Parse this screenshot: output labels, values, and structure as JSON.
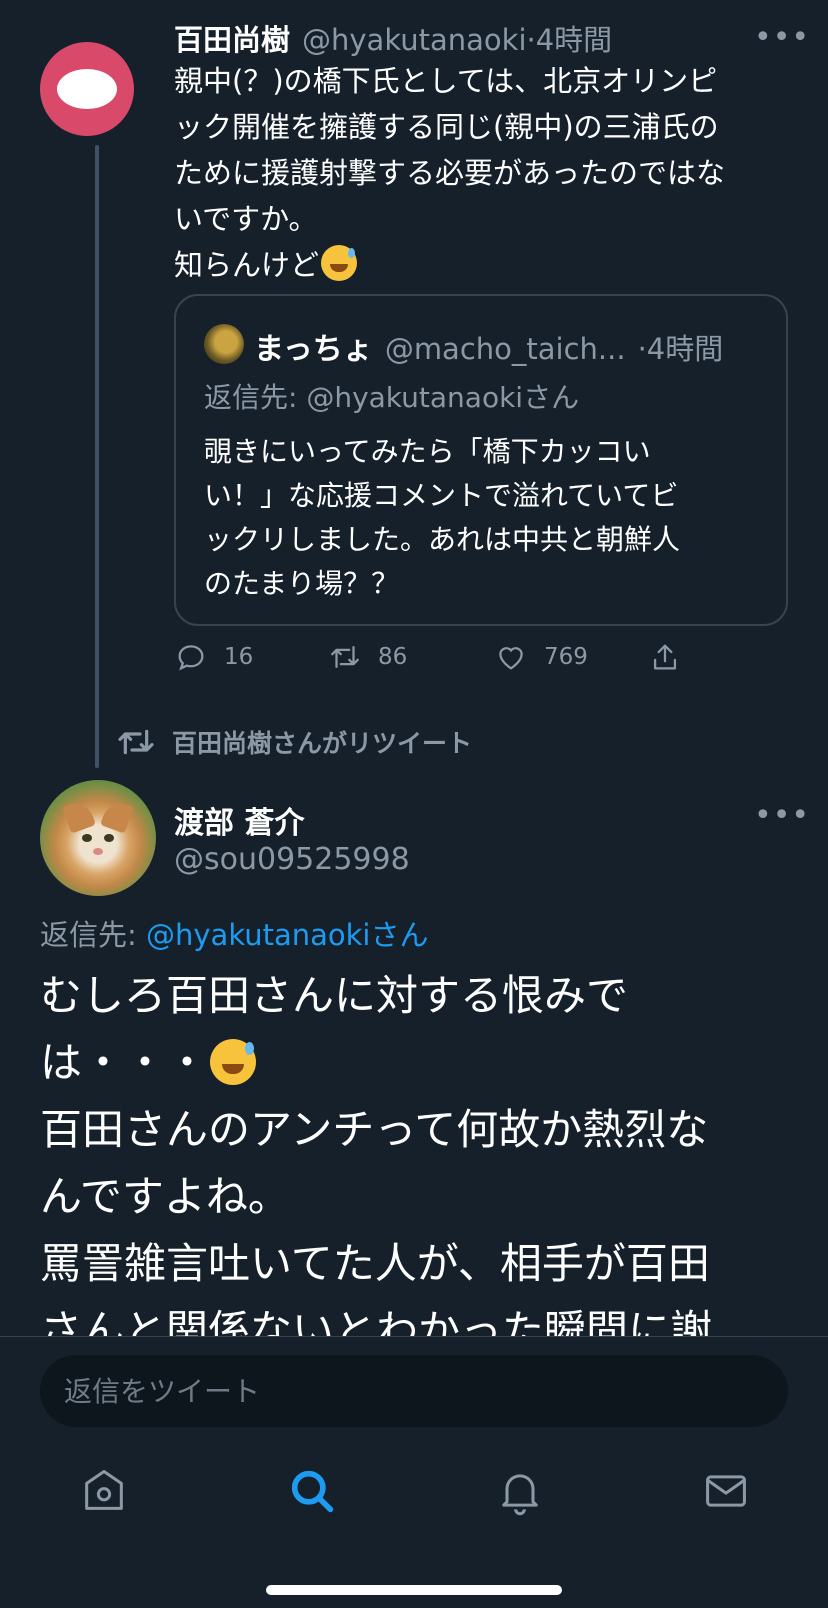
{
  "tweet1": {
    "name": "百田尚樹",
    "handle": "@hyakutanaoki",
    "time": "·4時間",
    "text_lines": [
      "親中(？)の橋下氏としては、北京オリンピ",
      "ック開催を擁護する同じ(親中)の三浦氏の",
      "ために援護射撃する必要があったのではな",
      "いですか。",
      "知らんけど"
    ],
    "emoji": "grinning-face-with-sweat",
    "quote": {
      "name": "まっちょ",
      "handle": "@macho_taich...",
      "time": "·4時間",
      "reply_to": "返信先: @hyakutanaokiさん",
      "text_lines": [
        "覗きにいってみたら「橋下カッコい",
        "い！」な応援コメントで溢れていてビ",
        "ックリしました。あれは中共と朝鮮人",
        "のたまり場？？"
      ]
    },
    "actions": {
      "replies": "16",
      "retweets": "86",
      "likes": "769"
    }
  },
  "retweet_notice": "百田尚樹さんがリツイート",
  "tweet2": {
    "name": "渡部 蒼介",
    "handle": "@sou09525998",
    "reply_prefix": "返信先: ",
    "reply_mention": "@hyakutanaokiさん",
    "text_lines": [
      "むしろ百田さんに対する恨みで",
      "は・・・",
      "百田さんのアンチって何故か熱烈な",
      "んですよね。",
      "罵詈雑言吐いてた人が、相手が百田",
      "さんと関係ないとわかった瞬間に謝"
    ]
  },
  "reply_box": {
    "placeholder": "返信をツイート"
  },
  "tab_bar": {
    "items": [
      "home-icon",
      "search-icon",
      "notifications-icon",
      "messages-icon"
    ],
    "active": "search-icon",
    "active_color": "#1d9bf0"
  }
}
